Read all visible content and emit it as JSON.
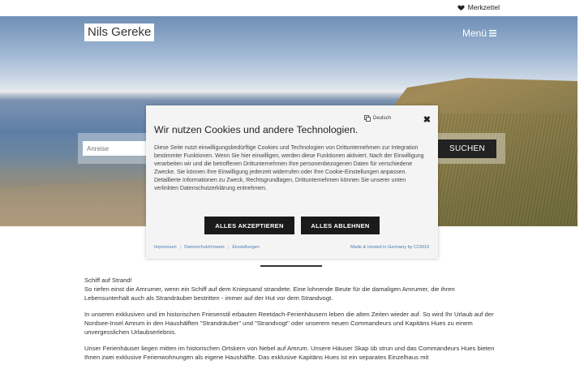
{
  "topbar": {
    "merkzettel_label": "Merkzettel",
    "merkzettel_icon": "heart-icon"
  },
  "header": {
    "logo": "Nils Gereke",
    "menu_label": "Menü",
    "menu_icon": "hamburger-icon"
  },
  "search": {
    "anreise_placeholder": "Anreise",
    "button_label": "SUCHEN"
  },
  "cookie_banner": {
    "language": "Deutsch",
    "language_icon": "translate-icon",
    "close_icon": "close-icon",
    "title": "Wir nutzen Cookies und andere Technologien.",
    "text": "Diese Seite nutzt einwilligungsbedürftige Cookies und Technologien von Drittunternehmen zur Integration bestimmter Funktionen. Wenn Sie hier einwilligen, werden diese Funktionen aktiviert. Nach der Einwilligung verarbeiten wir und die betroffenen Drittunternehmen Ihre personenbezogenen Daten für verschiedene Zwecke. Sie können Ihre Einwilligung jederzeit widerrufen oder Ihre Cookie-Einstellungen anpassen. Detaillierte Informationen zu Zweck, Rechtsgrundlagen, Drittunternehmen können Sie unserer unten verlinkten Datenschutzerklärung entnehmen.",
    "accept_label": "ALLES AKZEPTIEREN",
    "reject_label": "ALLES ABLEHNEN",
    "links": [
      "Impressum",
      "Datenschutzhinweis",
      "Einstellungen"
    ],
    "made_hosted": "Made & Hosted in Germany by CCM19"
  },
  "content": {
    "p1_line1": "Schiff auf Strand!",
    "p1_line2": "So riefen einst die Amrumer, wenn ein Schiff auf dem Kniepsand strandete. Eine lohnende Beute für die damaligen Amrumer, die ihren Lebensunterhalt auch als Strandräuber bestritten - immer auf der Hut vor dem Strandvogt.",
    "p2": "In unseren exklusiven und im historischen Friesenstil erbauten Reetdach-Ferienhäusern leben die alten Zeiten wieder auf. So wird Ihr Urlaub auf der Nordsee-Insel Amrum in den Haushälften \"Strandräuber\" und \"Strandvogt\" oder unserem neuen Commandeurs und Kapitäns Hues zu einem unvergesslichen Urlaubserlebnis.",
    "p3": "Unser Ferienhäuser liegen mitten im historischen Ortskern von Nebel auf Amrum. Unsere Häuser Skap üb strun und das Commandeurs Hues  bieten Ihnen zwei exklusive Ferienwohnungen als eigene Haushälfte. Das exklusive Kapitäns Hues ist ein separates Einzelhaus mit"
  },
  "colors": {
    "button_dark": "#1a1a1a",
    "link_blue": "#4a7fb5"
  }
}
